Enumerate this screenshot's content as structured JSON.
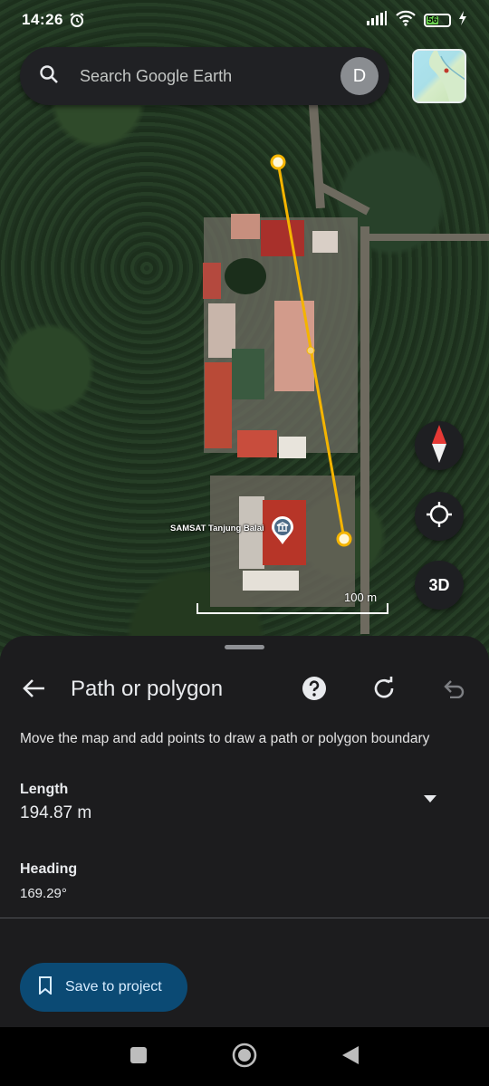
{
  "status_bar": {
    "time": "14:26",
    "battery_level": "56"
  },
  "search": {
    "placeholder": "Search Google Earth",
    "avatar_initial": "D"
  },
  "map": {
    "place_label": "SAMSAT Tanjung Balai",
    "scale_label": "100 m",
    "control_3d_label": "3D",
    "path_color": "#f4b400"
  },
  "sheet": {
    "title": "Path or polygon",
    "instructions": "Move the map and add points to draw a path or polygon boundary",
    "length": {
      "label": "Length",
      "value": "194.87 m"
    },
    "heading": {
      "label": "Heading",
      "value": "169.29°"
    },
    "save_button_label": "Save to project"
  },
  "icons": {
    "search": "search-icon",
    "back": "arrow-back-icon",
    "help": "help-icon",
    "refresh": "refresh-icon",
    "undo": "undo-icon",
    "compass": "compass-icon",
    "my_location": "my-location-icon",
    "bookmark": "bookmark-icon",
    "recents": "nav-recents-icon",
    "home": "nav-home-icon",
    "back_nav": "nav-back-icon"
  },
  "colors": {
    "accent": "#0b4a74",
    "sheet_bg": "#1c1c1e"
  }
}
